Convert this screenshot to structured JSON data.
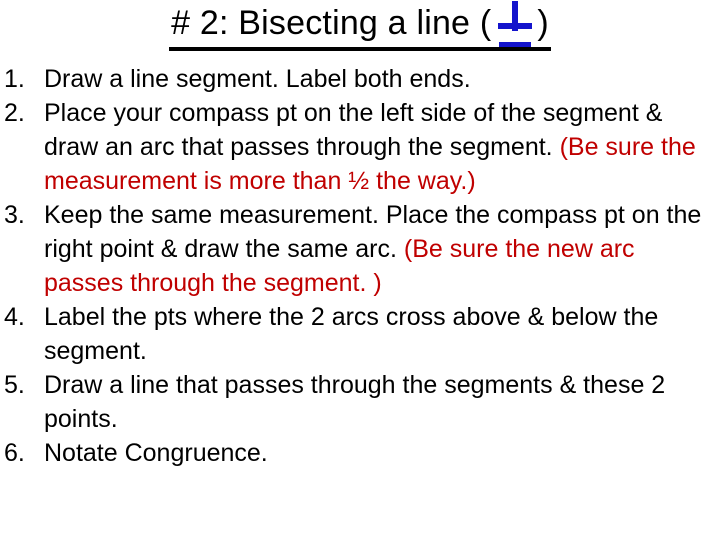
{
  "slide": {
    "title_prefix": "# 2: Bisecting a line (",
    "title_symbol_name": "perpendicular-symbol",
    "title_suffix": ")",
    "title_full": "# 2: Bisecting a line ( ⊥ )",
    "colors": {
      "text": "#000000",
      "emphasis_red": "#c00000",
      "symbol_blue": "#1414cc",
      "background": "#ffffff"
    },
    "steps": [
      {
        "number": "1.",
        "black_1": "Draw a line segment. Label both ends.",
        "red": "",
        "black_2": ""
      },
      {
        "number": "2.",
        "black_1": "Place your compass pt on the left side of the segment & draw an arc that passes through the segment. ",
        "red": "(Be sure the measurement is more than ½ the way.)",
        "black_2": ""
      },
      {
        "number": "3.",
        "black_1": "Keep the same measurement. Place the compass pt on the right point & draw the same arc. ",
        "red": "(Be sure the new arc passes through the segment. )",
        "black_2": ""
      },
      {
        "number": "4.",
        "black_1": "Label the pts where the 2 arcs cross above & below the segment.",
        "red": "",
        "black_2": ""
      },
      {
        "number": "5.",
        "black_1": "Draw a line that passes through the segments & these 2 points.",
        "red": "",
        "black_2": ""
      },
      {
        "number": "6.",
        "black_1": "Notate Congruence.",
        "red": "",
        "black_2": ""
      }
    ]
  }
}
